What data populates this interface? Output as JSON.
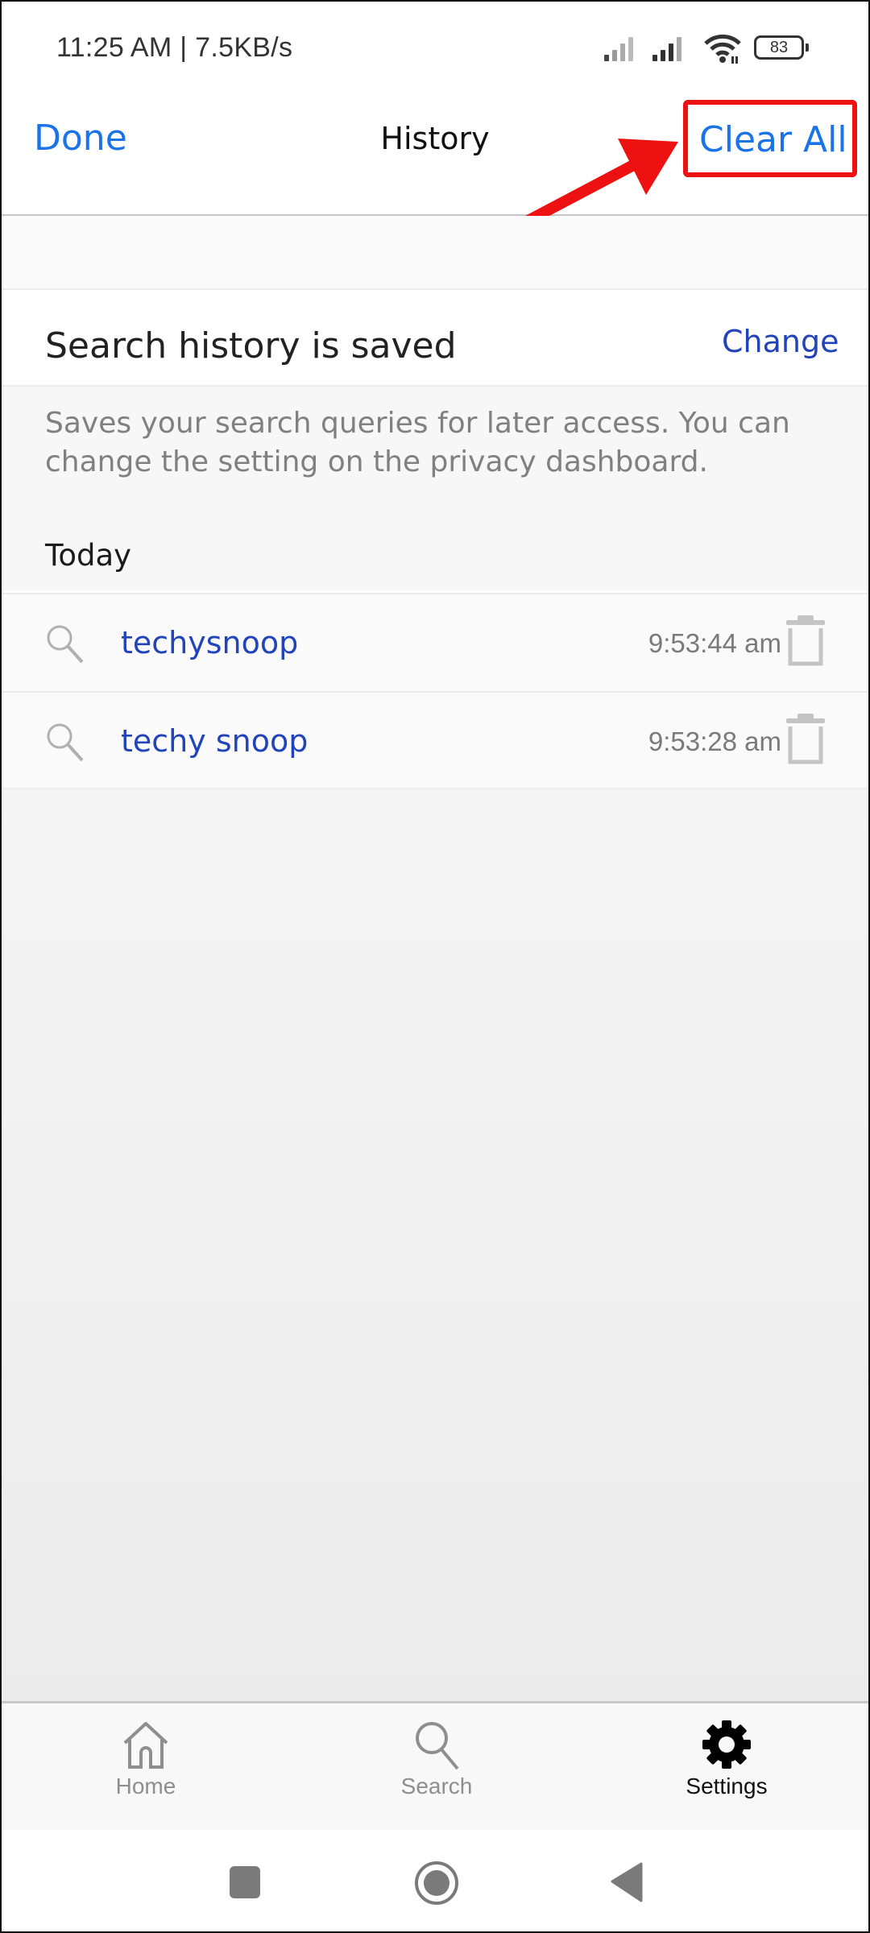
{
  "status_bar": {
    "time_speed": "11:25 AM | 7.5KB/s",
    "battery_level": "83",
    "icons": [
      "signal-1-icon",
      "signal-2-icon",
      "wifi-icon",
      "battery-icon"
    ]
  },
  "header": {
    "left_button": "Done",
    "title": "History",
    "right_button": "Clear All"
  },
  "annotation": {
    "highlight_color": "#ee1111",
    "arrow_target": "Clear All"
  },
  "history_setting": {
    "title": "Search history is saved",
    "change_label": "Change",
    "description": "Saves your search queries for later access. You can change the setting on the privacy dashboard."
  },
  "history": {
    "section_label": "Today",
    "items": [
      {
        "query": "techysnoop",
        "time": "9:53:44 am"
      },
      {
        "query": "techy snoop",
        "time": "9:53:28 am"
      }
    ]
  },
  "tab_bar": {
    "tabs": [
      {
        "label": "Home",
        "icon": "home-icon",
        "active": false
      },
      {
        "label": "Search",
        "icon": "search-icon",
        "active": false
      },
      {
        "label": "Settings",
        "icon": "gear-icon",
        "active": true
      }
    ]
  },
  "system_nav": {
    "buttons": [
      "recents-button",
      "home-button",
      "back-button"
    ]
  },
  "colors": {
    "accent": "#1a73e8",
    "link": "#2244bb",
    "annotation": "#ee1111"
  }
}
